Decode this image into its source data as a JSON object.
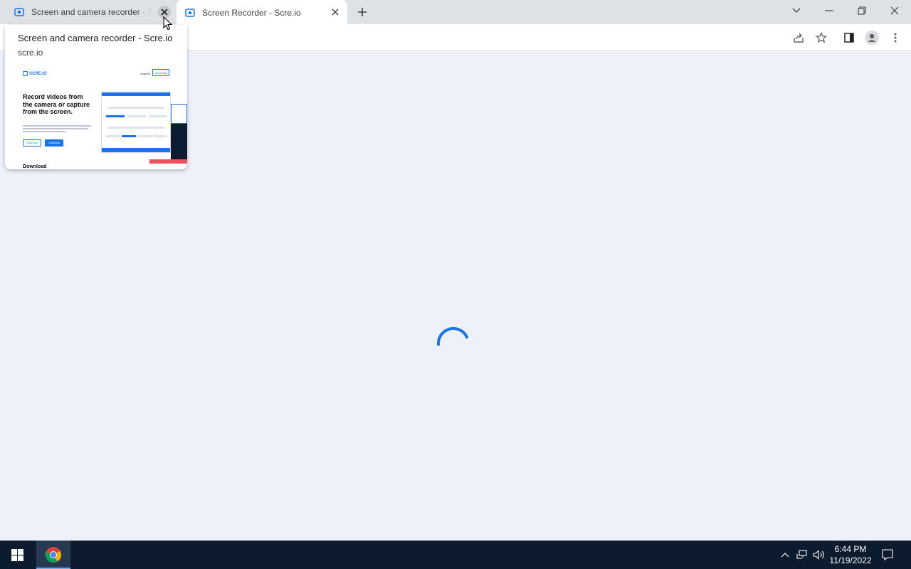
{
  "browser": {
    "tabs": [
      {
        "title": "Screen and camera recorder - Scre.io",
        "active": false
      },
      {
        "title": "Screen Recorder - Scre.io",
        "active": true
      }
    ]
  },
  "hover_card": {
    "title": "Screen and camera recorder - Scre.io",
    "domain": "scre.io",
    "preview": {
      "logo": "SCRE.IO",
      "nav_link": "Support",
      "nav_button": "Download",
      "headline": "Record videos from the camera or capture from the screen.",
      "button_try": "Try it now",
      "button_download": "Download",
      "section_heading": "Download"
    }
  },
  "page": {
    "state": "loading"
  },
  "taskbar": {
    "time": "6:44 PM",
    "date": "11/19/2022"
  },
  "colors": {
    "accent": "#1a73e8",
    "content_bg": "#eef1fa",
    "taskbar_bg": "#0d1b2e",
    "tabstrip_bg": "#dee1e6"
  }
}
